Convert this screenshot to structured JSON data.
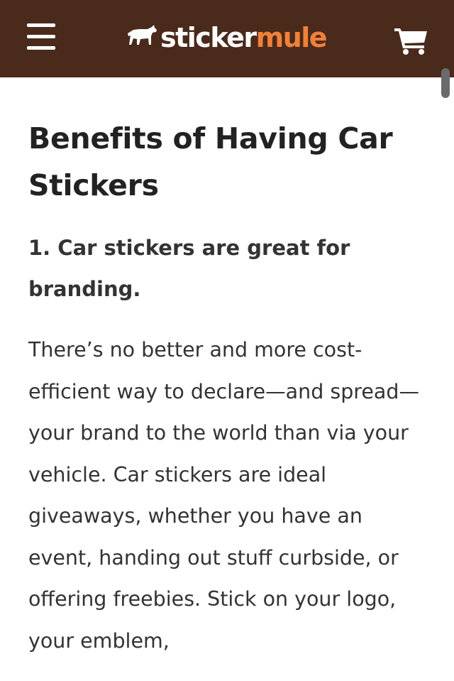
{
  "colors": {
    "header_bg": "#4a2a1b",
    "brand_accent": "#f1813a",
    "text": "#333333"
  },
  "header": {
    "menu_icon": "hamburger-menu-icon",
    "logo": {
      "icon": "mule-icon",
      "part1": "sticker",
      "part2": "mule"
    },
    "cart_icon": "shopping-cart-icon"
  },
  "article": {
    "title": "Benefits of Having Car Stickers",
    "subheading": "1. Car stickers are great for branding.",
    "paragraph": "There’s no better and more cost-efficient way to declare—and spread—your brand to the world than via your vehicle. Car stickers are ideal giveaways, whether you have an event, handing out stuff curbside, or offering freebies. Stick on your logo, your emblem,"
  }
}
